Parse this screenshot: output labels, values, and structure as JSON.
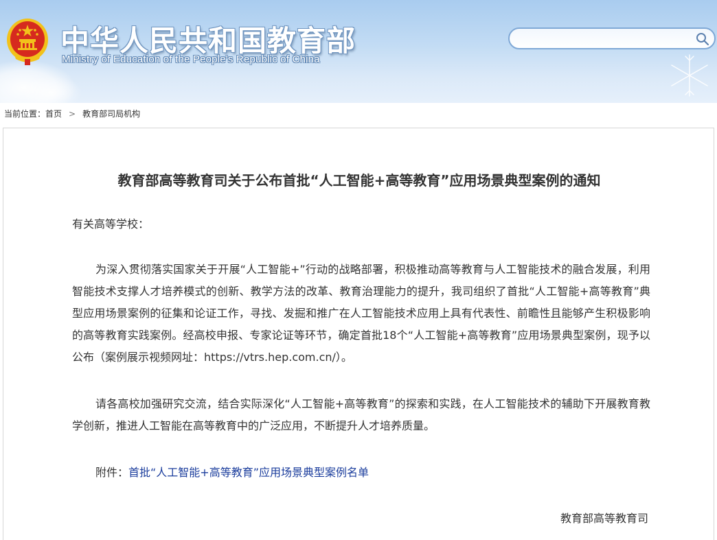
{
  "header": {
    "title": "中华人民共和国教育部",
    "subtitle": "Ministry of Education of the People's Republic of China",
    "search": {
      "placeholder": ""
    }
  },
  "breadcrumb": {
    "prefix": "当前位置：",
    "items": [
      "首页",
      "教育部司局机构"
    ]
  },
  "article": {
    "title": "教育部高等教育司关于公布首批“人工智能+高等教育”应用场景典型案例的通知",
    "greeting": "有关高等学校：",
    "paragraphs": [
      "为深入贯彻落实国家关于开展“人工智能+”行动的战略部署，积极推动高等教育与人工智能技术的融合发展，利用智能技术支撑人才培养模式的创新、教学方法的改革、教育治理能力的提升，我司组织了首批“人工智能+高等教育”典型应用场景案例的征集和论证工作，寻找、发掘和推广在人工智能技术应用上具有代表性、前瞻性且能够产生积极影响的高等教育实践案例。经高校申报、专家论证等环节，确定首批18个“人工智能+高等教育”应用场景典型案例，现予以公布（案例展示视频网址：https://vtrs.hep.com.cn/）。",
      "请各高校加强研究交流，结合实际深化“人工智能+高等教育”的探索和实践，在人工智能技术的辅助下开展教育教学创新，推进人工智能在高等教育中的广泛应用，不断提升人才培养质量。"
    ],
    "attachment_label": "附件：",
    "attachment_link": "首批“人工智能+高等教育”应用场景典型案例名单",
    "signature": "教育部高等教育司"
  },
  "colors": {
    "header_top": "#a9ccef",
    "header_bottom": "#e6f0fb",
    "link": "#1a3c9c",
    "text": "#333333",
    "search_border": "#7fa8d6",
    "emblem_red": "#d62a1e",
    "emblem_gold": "#f2c21b"
  },
  "icons": {
    "emblem": "national-emblem-icon",
    "search": "search-icon",
    "separator": "chevron-right-icon"
  }
}
